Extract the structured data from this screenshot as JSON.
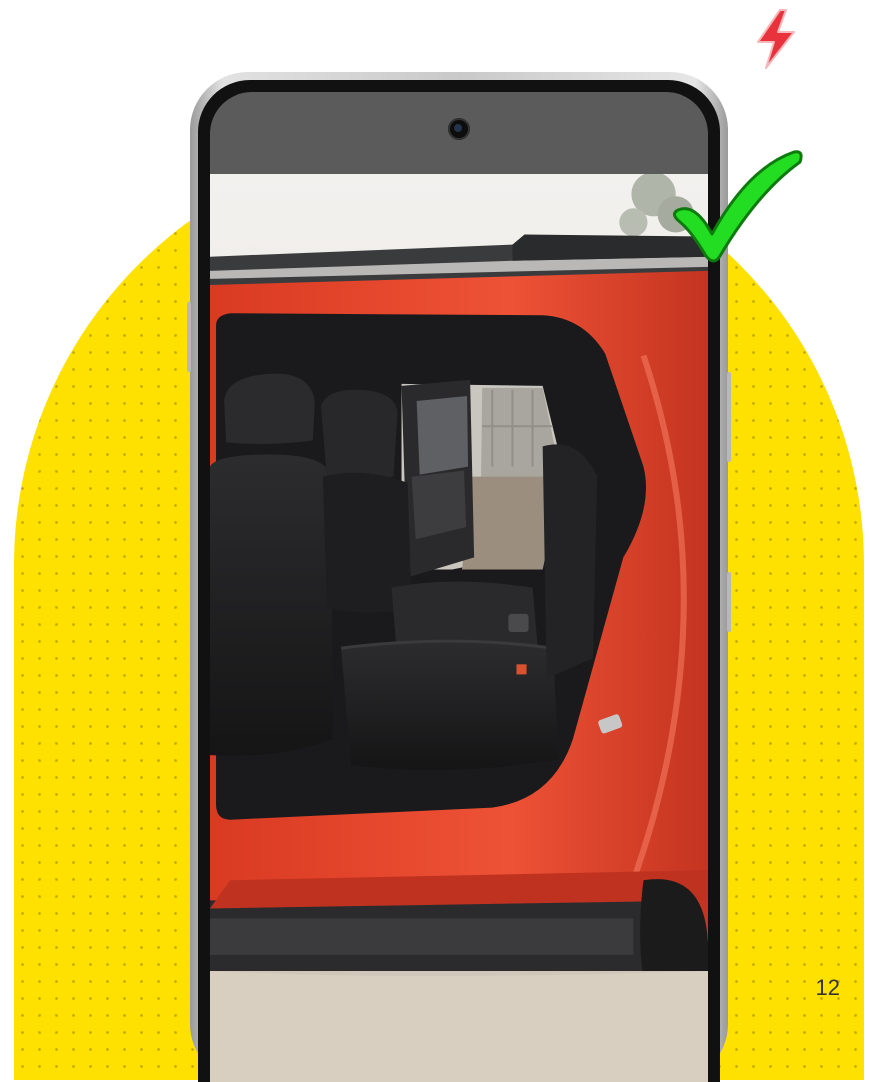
{
  "page": {
    "page_number": "12"
  },
  "colors": {
    "arch_yellow": "#FFE100",
    "check_green": "#22DD22",
    "bolt_red": "#E8323C",
    "car_orange": "#E8452B"
  },
  "icons": {
    "checkmark": "checkmark-icon",
    "lightning": "lightning-bolt-icon",
    "camera": "front-camera-icon"
  }
}
